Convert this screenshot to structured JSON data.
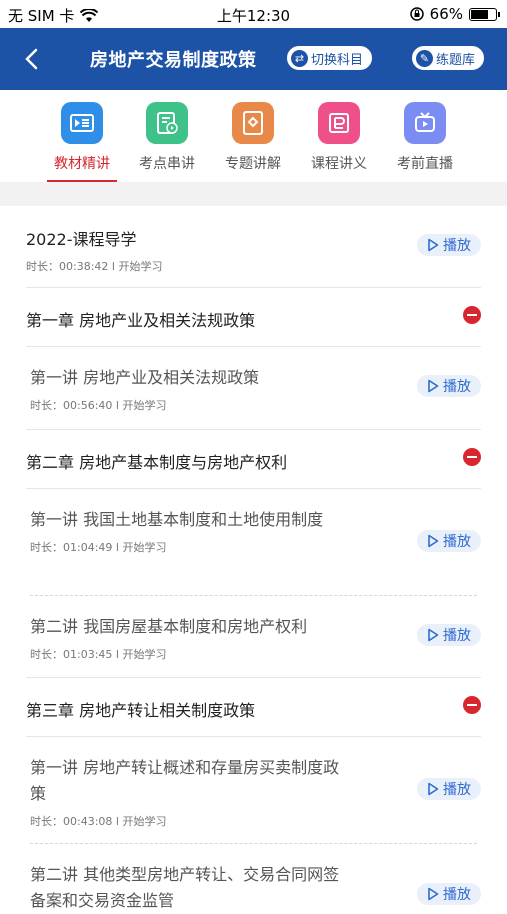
{
  "status_bar": {
    "carrier": "无 SIM 卡",
    "time": "上午12:30",
    "battery": "66%"
  },
  "nav": {
    "title": "房地产交易制度政策",
    "switch_subject": "切换科目",
    "question_bank": "练题库"
  },
  "tabs": [
    {
      "label": "教材精讲",
      "color": "#2f8fe8",
      "active": true
    },
    {
      "label": "考点串讲",
      "color": "#3fc18a"
    },
    {
      "label": "专题讲解",
      "color": "#e8894a"
    },
    {
      "label": "课程讲义",
      "color": "#f0508a"
    },
    {
      "label": "考前直播",
      "color": "#7b8df2"
    }
  ],
  "play_label": "播放",
  "intro": {
    "title": "2022-课程导学",
    "meta": "时长：00:38:42 l 开始学习"
  },
  "chapters": [
    {
      "title": "第一章 房地产业及相关法规政策",
      "lessons": [
        {
          "title": "第一讲 房地产业及相关法规政策",
          "meta": "时长：00:56:40 l 开始学习"
        }
      ]
    },
    {
      "title": "第二章 房地产基本制度与房地产权利",
      "lessons": [
        {
          "title": "第一讲 我国土地基本制度和土地使用制度",
          "meta": "时长：01:04:49 l 开始学习"
        },
        {
          "title": "第二讲 我国房屋基本制度和房地产权利",
          "meta": "时长：01:03:45 l 开始学习"
        }
      ]
    },
    {
      "title": "第三章 房地产转让相关制度政策",
      "lessons": [
        {
          "title": "第一讲 房地产转让概述和存量房买卖制度政策",
          "meta": "时长：00:43:08 l 开始学习"
        },
        {
          "title": "第二讲 其他类型房地产转让、交易合同网签备案和交易资金监管",
          "meta": ""
        }
      ]
    }
  ]
}
